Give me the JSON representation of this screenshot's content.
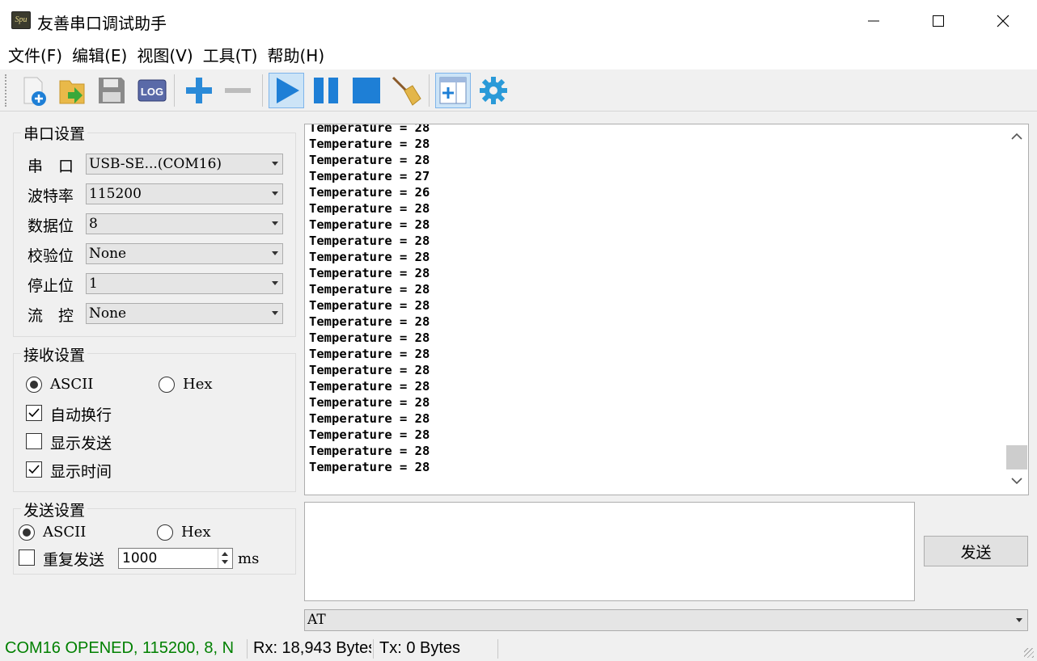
{
  "window": {
    "title": "友善串口调试助手",
    "icon_text": "Spu"
  },
  "menu": [
    "文件(F)",
    "编辑(E)",
    "视图(V)",
    "工具(T)",
    "帮助(H)"
  ],
  "toolbar": {
    "buttons": [
      "new-file-icon",
      "open-folder-icon",
      "save-icon",
      "log-icon",
      "add-icon",
      "remove-icon",
      "play-icon",
      "pause-icon",
      "stop-icon",
      "broom-icon",
      "window-add-icon",
      "gear-icon"
    ],
    "log_label": "LOG"
  },
  "serial_settings": {
    "title": "串口设置",
    "rows": [
      {
        "label": "串　口",
        "value": "USB-SE...(COM16)"
      },
      {
        "label": "波特率",
        "value": "115200"
      },
      {
        "label": "数据位",
        "value": "8"
      },
      {
        "label": "校验位",
        "value": "None"
      },
      {
        "label": "停止位",
        "value": "1"
      },
      {
        "label": "流　控",
        "value": "None"
      }
    ]
  },
  "receive_settings": {
    "title": "接收设置",
    "ascii_label": "ASCII",
    "hex_label": "Hex",
    "mode": "ASCII",
    "options": [
      {
        "label": "自动换行",
        "checked": true
      },
      {
        "label": "显示发送",
        "checked": false
      },
      {
        "label": "显示时间",
        "checked": true
      }
    ]
  },
  "send_settings": {
    "title": "发送设置",
    "ascii_label": "ASCII",
    "hex_label": "Hex",
    "mode": "ASCII",
    "repeat_label": "重复发送",
    "repeat_checked": false,
    "interval": "1000",
    "unit": "ms"
  },
  "receive_lines": [
    "Temperature = 28",
    "Temperature = 28",
    "Temperature = 28",
    "Temperature = 27",
    "Temperature = 26",
    "Temperature = 28",
    "Temperature = 28",
    "Temperature = 28",
    "Temperature = 28",
    "Temperature = 28",
    "Temperature = 28",
    "Temperature = 28",
    "Temperature = 28",
    "Temperature = 28",
    "Temperature = 28",
    "Temperature = 28",
    "Temperature = 28",
    "Temperature = 28",
    "Temperature = 28",
    "Temperature = 28",
    "Temperature = 28",
    "Temperature = 28"
  ],
  "send": {
    "button_label": "发送",
    "command": "AT"
  },
  "status": {
    "port": "COM16 OPENED, 115200, 8, N",
    "rx": "Rx: 18,943 Bytes",
    "tx": "Tx: 0 Bytes"
  },
  "colors": {
    "status_ok": "#008000",
    "accent_blue": "#1e7fd6"
  }
}
